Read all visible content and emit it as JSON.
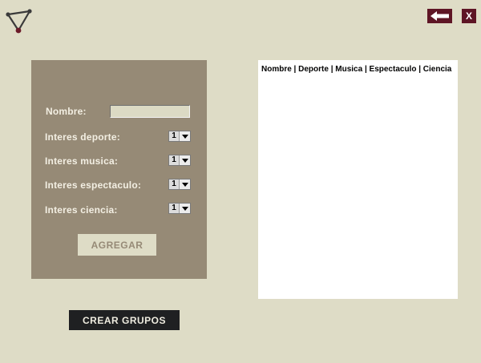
{
  "header": {
    "logo_icon": "triangle-graph-icon",
    "back_icon": "arrow-left-icon",
    "close_label": "X"
  },
  "form": {
    "name_label": "Nombre:",
    "name_value": "",
    "fields": [
      {
        "label": "Interes deporte:",
        "value": "1"
      },
      {
        "label": "Interes musica:",
        "value": "1"
      },
      {
        "label": "Interes espectaculo:",
        "value": "1"
      },
      {
        "label": "Interes ciencia:",
        "value": "1"
      }
    ],
    "add_label": "AGREGAR"
  },
  "list": {
    "header": "Nombre | Deporte | Musica | Espectaculo | Ciencia"
  },
  "actions": {
    "create_groups_label": "CREAR GRUPOS"
  },
  "colors": {
    "background": "#dedcc6",
    "panel": "#968a76",
    "accent": "#5e1525",
    "dark_button": "#1f2022"
  }
}
